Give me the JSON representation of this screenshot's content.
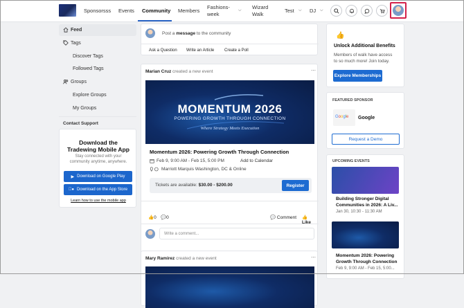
{
  "nav": {
    "items": [
      {
        "label": "Sponsorsss"
      },
      {
        "label": "Events"
      },
      {
        "label": "Community"
      },
      {
        "label": "Members"
      },
      {
        "label": "Fashions-\nweek"
      },
      {
        "label": "Wizard\nWalk"
      },
      {
        "label": "Test"
      },
      {
        "label": "DJ"
      }
    ],
    "fashions_line1": "Fashions-",
    "fashions_line2": "week",
    "wizard_line1": "Wizard",
    "wizard_line2": "Walk"
  },
  "sidebar": {
    "feed": "Feed",
    "tags": "Tags",
    "discover_tags": "Discover Tags",
    "followed_tags": "Followed Tags",
    "groups": "Groups",
    "explore_groups": "Explore Groups",
    "my_groups": "My Groups",
    "contact_support": "Contact Support",
    "app_title_1": "Download the",
    "app_title_2": "Tradewing Mobile App",
    "app_sub_1": "Stay connected with your",
    "app_sub_2": "community anytime, anywhere.",
    "google_play": "Download on Google Play",
    "app_store": "Download on the App Store",
    "learn_link": "Learn how to use the mobile app"
  },
  "composer": {
    "prompt_pre": "Post a ",
    "prompt_bold": "message",
    "prompt_post": " to the community",
    "ask": "Ask a Question",
    "article": "Write an Article",
    "poll": "Create a Poll"
  },
  "post1": {
    "author": "Marian Cruz",
    "action": " created a new event",
    "banner_title": "MOMENTUM 2026",
    "banner_sub": "POWERING GROWTH THROUGH CONNECTION",
    "banner_tag": "Where Strategy Meets Execution",
    "event_title": "Momentum 2026: Powering Growth Through Connection",
    "dates": "Feb 9, 9:00 AM - Feb 15, 5:00 PM",
    "add_cal": "Add to Calendar",
    "location": "Marriott Marquis Washington, DC & Online",
    "tickets_pre": "Tickets are available: ",
    "tickets_price": "$30.00 - $200.00",
    "register": "Register",
    "likes": "0",
    "comments": "0",
    "comment_label": "Comment",
    "like_label": "Like",
    "write_comment": "Write a comment..."
  },
  "post2": {
    "author": "Mary Ramirez",
    "action": " created a new event"
  },
  "right": {
    "unlock_title": "Unlock Additional Benefits",
    "unlock_text_1": "Members of walk have access",
    "unlock_text_2": "to so much more! Join today.",
    "explore_btn": "Explore Memberships",
    "featured": "FEATURED SPONSOR",
    "sponsor_name": "Google",
    "demo_btn": "Request a Demo",
    "upcoming": "UPCOMING EVENTS",
    "ev1_title_1": "Building Stronger Digital",
    "ev1_title_2": "Communities in 2026: A Liv...",
    "ev1_date": "Jan 30, 10:30 - 11:30 AM",
    "ev2_title_1": "Momentum 2026: Powering",
    "ev2_title_2": "Growth Through Connection",
    "ev2_date": "Feb 9, 9:00 AM - Feb 15, 5:00..."
  }
}
